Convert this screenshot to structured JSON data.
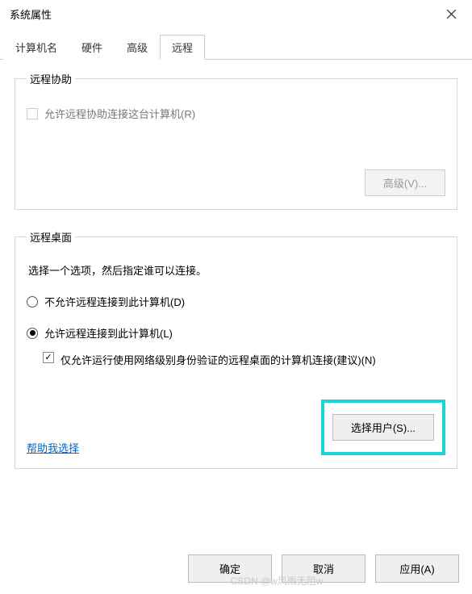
{
  "window": {
    "title": "系统属性"
  },
  "tabs": {
    "computer_name": "计算机名",
    "hardware": "硬件",
    "advanced": "高级",
    "remote": "远程"
  },
  "remote_assistance": {
    "legend": "远程协助",
    "allow_checkbox_label": "允许远程协助连接这台计算机(R)",
    "advanced_button": "高级(V)..."
  },
  "remote_desktop": {
    "legend": "远程桌面",
    "instruction": "选择一个选项，然后指定谁可以连接。",
    "radio_disallow": "不允许远程连接到此计算机(D)",
    "radio_allow": "允许远程连接到此计算机(L)",
    "nla_checkbox_label": "仅允许运行使用网络级别身份验证的远程桌面的计算机连接(建议)(N)",
    "help_link": "帮助我选择",
    "select_users_button": "选择用户(S)..."
  },
  "dialog_buttons": {
    "ok": "确定",
    "cancel": "取消",
    "apply": "应用(A)"
  },
  "watermark": "CSDN @w风雨无阻w"
}
